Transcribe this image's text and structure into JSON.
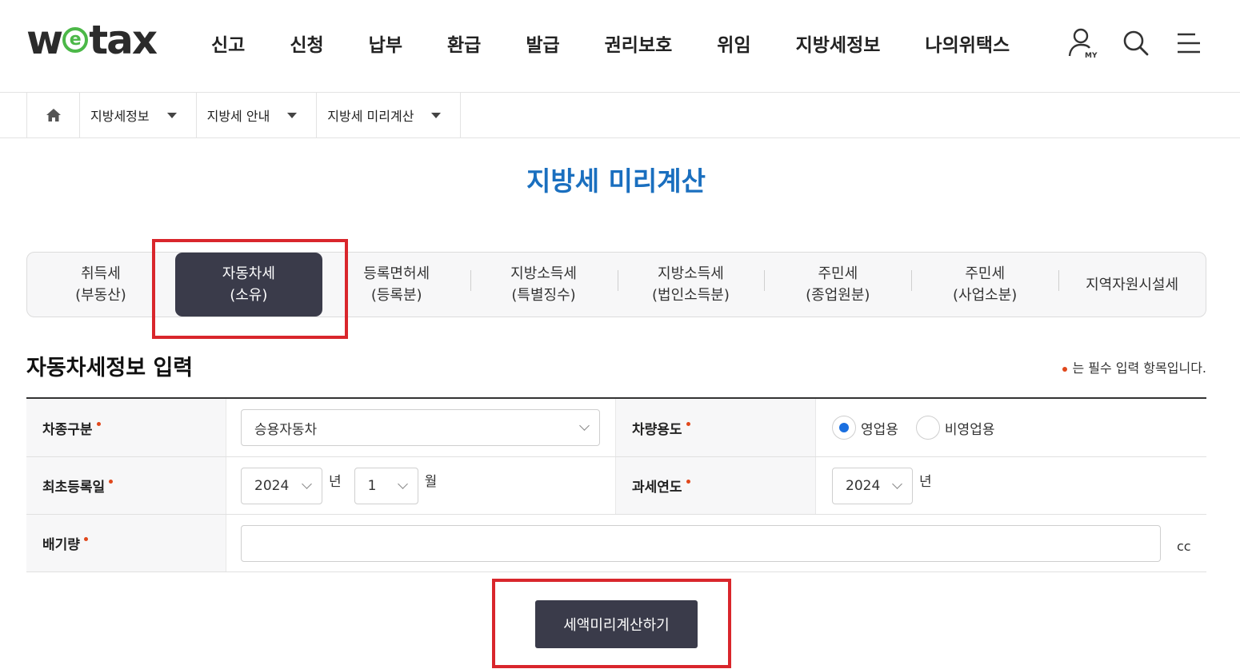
{
  "header": {
    "logo": {
      "pre": "w",
      "mid": "e",
      "post": "tax"
    },
    "nav": [
      "신고",
      "신청",
      "납부",
      "환급",
      "발급",
      "권리보호",
      "위임",
      "지방세정보",
      "나의위택스"
    ],
    "icons": [
      "my-user-icon",
      "search-icon",
      "menu-icon"
    ]
  },
  "breadcrumb": {
    "items": [
      "지방세정보",
      "지방세 안내",
      "지방세 미리계산"
    ]
  },
  "page": {
    "title": "지방세 미리계산"
  },
  "tabs": [
    {
      "label": "취득세\n(부동산)",
      "active": false
    },
    {
      "label": "자동차세\n(소유)",
      "active": true
    },
    {
      "label": "등록면허세\n(등록분)",
      "active": false
    },
    {
      "label": "지방소득세\n(특별징수)",
      "active": false
    },
    {
      "label": "지방소득세\n(법인소득분)",
      "active": false
    },
    {
      "label": "주민세\n(종업원분)",
      "active": false
    },
    {
      "label": "주민세\n(사업소분)",
      "active": false
    },
    {
      "label": "지역자원시설세",
      "active": false
    }
  ],
  "section": {
    "title": "자동차세정보 입력",
    "required_note": "는 필수 입력 항목입니다."
  },
  "form": {
    "vehicle_type": {
      "label": "차종구분",
      "value": "승용자동차"
    },
    "vehicle_use": {
      "label": "차량용도",
      "options": [
        "영업용",
        "비영업용"
      ],
      "selected": "영업용"
    },
    "first_registration": {
      "label": "최초등록일",
      "year": "2024",
      "year_unit": "년",
      "month": "1",
      "month_unit": "월"
    },
    "tax_year": {
      "label": "과세연도",
      "year": "2024",
      "year_unit": "년"
    },
    "displacement": {
      "label": "배기량",
      "value": "",
      "unit": "cc"
    }
  },
  "submit": {
    "label": "세액미리계산하기"
  },
  "colors": {
    "accent_blue": "#1a6fbf",
    "dark_button": "#3a3b4a",
    "required_dot": "#e0471b",
    "highlight_red": "#d9262c"
  }
}
